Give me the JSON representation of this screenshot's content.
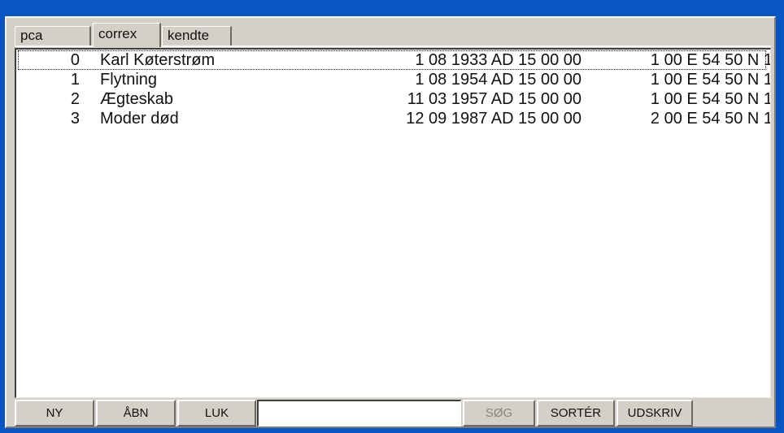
{
  "tabs": [
    "pca",
    "correx",
    "kendte"
  ],
  "events": [
    {
      "num": "0",
      "name": "Karl Køterstrøm",
      "date": "1 08 1933 AD 15 00 00",
      "coord": "1 00 E 54 50 N  1"
    },
    {
      "num": "1",
      "name": "Flytning",
      "date": "1 08 1954 AD 15 00 00",
      "coord": "1 00 E 54 50 N  1"
    },
    {
      "num": "2",
      "name": "Ægteskab",
      "date": "11 03 1957 AD 15 00 00",
      "coord": "1 00 E 54 50 N  1"
    },
    {
      "num": "3",
      "name": "Moder død",
      "date": "12 09 1987 AD 15 00 00",
      "coord": "2 00 E 54 50 N  1"
    }
  ],
  "toolbar": {
    "new_label": "NY",
    "open_label": "ÅBN",
    "close_label": "LUK",
    "search_value": "",
    "search_label": "SØG",
    "sort_label": "SORTÉR",
    "print_label": "UDSKRIV"
  },
  "colors": {
    "desktop": "#0a55c4",
    "window": "#d4d0c8"
  }
}
